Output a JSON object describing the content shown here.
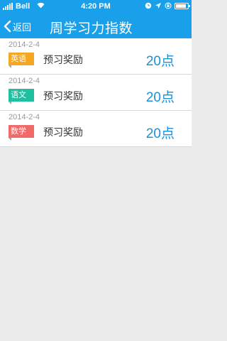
{
  "status_bar": {
    "carrier": "Bell",
    "time": "4:20 PM",
    "icons": [
      "signal-icon",
      "wifi-icon",
      "clock-icon",
      "location-icon",
      "lock-rotation-icon",
      "battery-icon"
    ]
  },
  "nav": {
    "back_label": "返回",
    "title": "周学习力指数",
    "back_icon": "chevron-left-icon"
  },
  "colors": {
    "nav_blue": "#1aa0ea",
    "points_blue": "#1e8ed9",
    "background": "#ececec"
  },
  "records": [
    {
      "date": "2014-2-4",
      "subject": "英语",
      "subject_color": "#f5a623",
      "description": "预习奖励",
      "points": "20点"
    },
    {
      "date": "2014-2-4",
      "subject": "语文",
      "subject_color": "#1fbfa0",
      "description": "预习奖励",
      "points": "20点"
    },
    {
      "date": "2014-2-4",
      "subject": "数学",
      "subject_color": "#f06a6a",
      "description": "预习奖励",
      "points": "20点"
    }
  ]
}
